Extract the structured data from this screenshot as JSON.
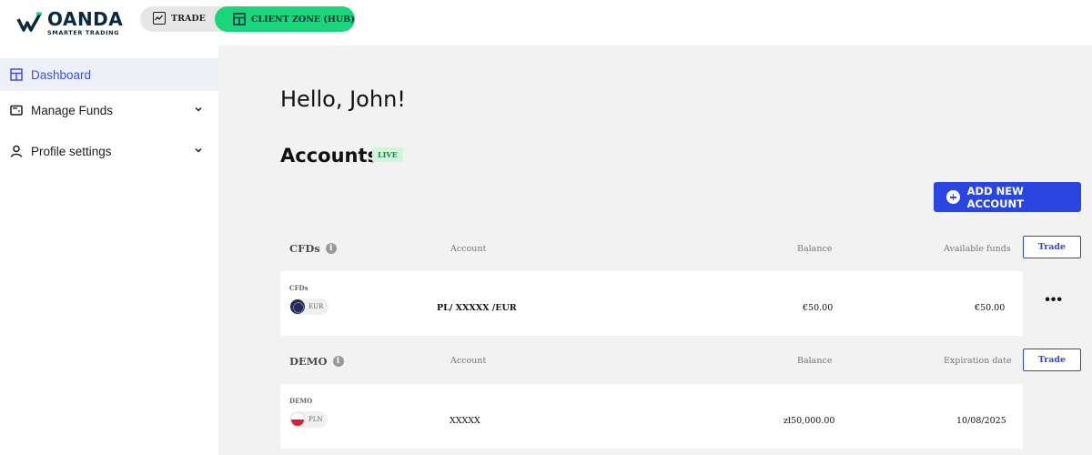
{
  "header": {
    "brand": "OANDA",
    "tagline": "SMARTER TRADING",
    "tabs": [
      {
        "label": "TRADE",
        "icon": "chart-line-icon"
      },
      {
        "label": "CLIENT ZONE (HUB)",
        "icon": "dashboard-icon",
        "active": true
      }
    ],
    "accent_color": "#1cd47a"
  },
  "sidebar": {
    "items": [
      {
        "label": "Dashboard",
        "icon": "dashboard-icon",
        "active": true
      },
      {
        "label": "Manage Funds",
        "icon": "wallet-icon",
        "expandable": true
      },
      {
        "label": "Profile settings",
        "icon": "user-icon",
        "expandable": true
      }
    ]
  },
  "main": {
    "greeting": "Hello, John!",
    "accounts_title": "Accounts",
    "live_badge": "LIVE",
    "add_account_label": "ADD NEW ACCOUNT",
    "sections": [
      {
        "title": "CFDs",
        "col_account": "Account",
        "col_balance": "Balance",
        "col_last": "Available funds",
        "trade_label": "Trade",
        "rows": [
          {
            "type": "CFDs",
            "currency": "EUR",
            "flag": "eu",
            "account": "PL/ XXXXX /EUR",
            "balance": "€50.00",
            "last": "€50.00",
            "menu": "•••"
          }
        ]
      },
      {
        "title": "DEMO",
        "col_account": "Account",
        "col_balance": "Balance",
        "col_last": "Expiration date",
        "trade_label": "Trade",
        "rows": [
          {
            "type": "DEMO",
            "currency": "PLN",
            "flag": "pl",
            "account": "XXXXX",
            "balance": "zł50,000.00",
            "last": "10/08/2025"
          }
        ]
      }
    ],
    "primary_color": "#2b46e0"
  }
}
